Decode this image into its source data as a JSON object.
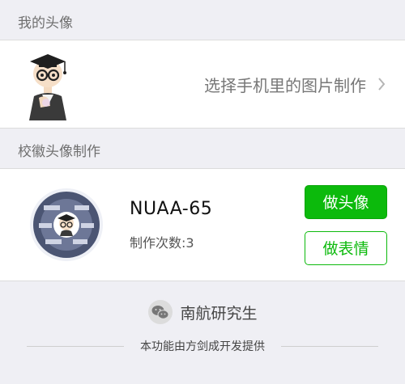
{
  "my_avatar": {
    "header": "我的头像",
    "choose_label": "选择手机里的图片制作"
  },
  "badge": {
    "header": "校徽头像制作",
    "name": "NUAA-65",
    "make_count": "制作次数:3",
    "make_avatar_label": "做头像",
    "make_sticker_label": "做表情"
  },
  "footer": {
    "brand": "南航研究生",
    "credit": "本功能由方剑成开发提供"
  },
  "colors": {
    "accent": "#0cba0c",
    "background": "#efeff4"
  }
}
